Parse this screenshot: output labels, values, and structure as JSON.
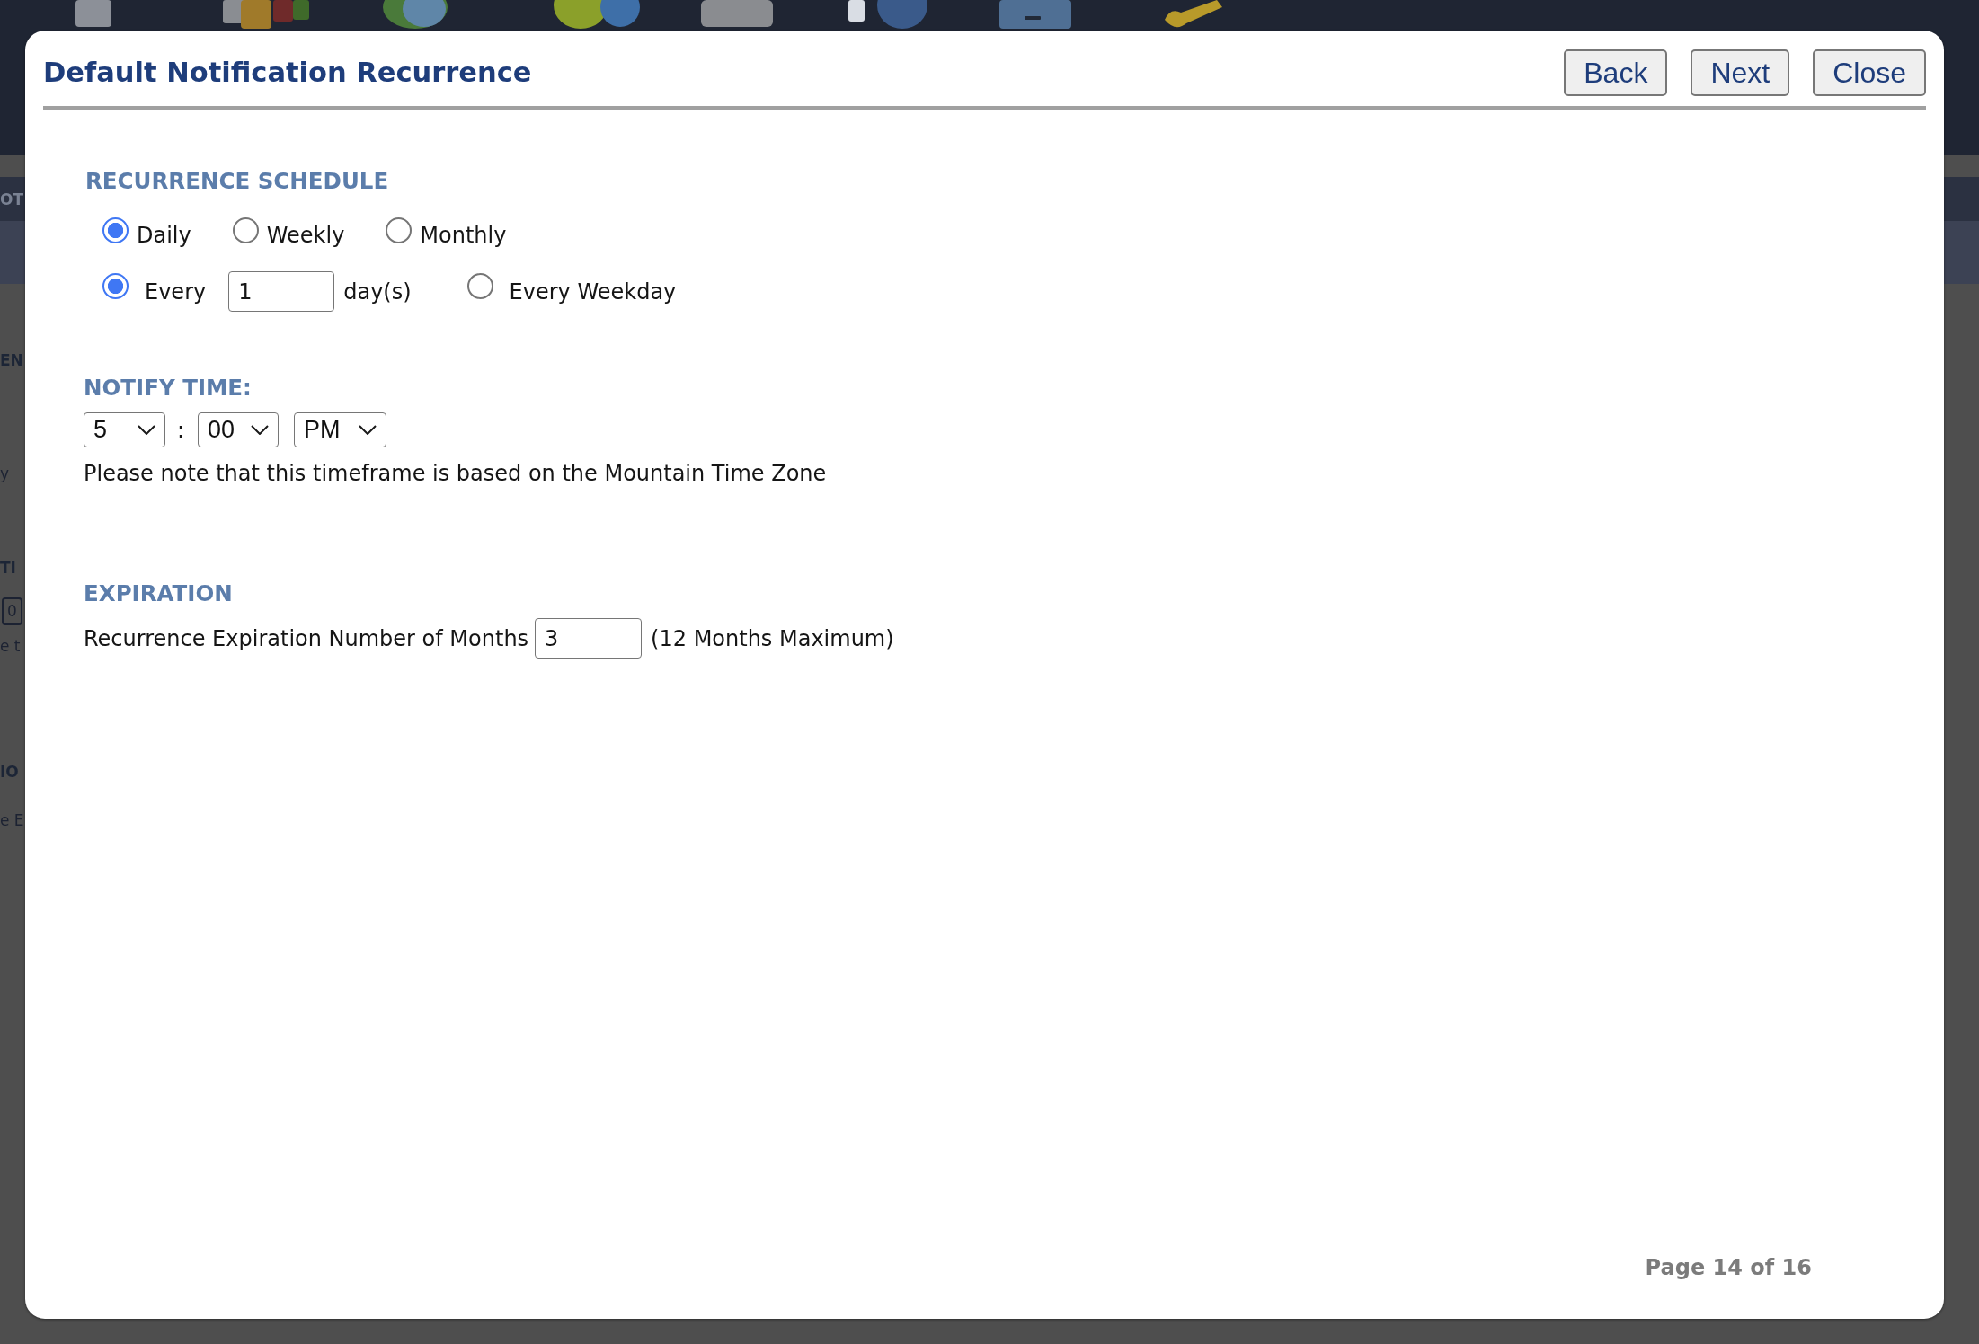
{
  "background_page": {
    "fragments": [
      {
        "kind": "tab",
        "text": "OT"
      },
      {
        "kind": "heading",
        "text": "EN"
      },
      {
        "kind": "text",
        "text": "y"
      },
      {
        "kind": "heading",
        "text": "TI"
      },
      {
        "kind": "field",
        "text": "0"
      },
      {
        "kind": "text",
        "text": "e t"
      },
      {
        "kind": "heading",
        "text": "IO"
      },
      {
        "kind": "text",
        "text": "e E"
      }
    ]
  },
  "dialog": {
    "title": "Default Notification Recurrence",
    "buttons": [
      "Back",
      "Next",
      "Close"
    ],
    "recurrence_schedule": {
      "heading": "RECURRENCE SCHEDULE",
      "frequency_options": [
        {
          "label": "Daily",
          "selected": true
        },
        {
          "label": "Weekly",
          "selected": false
        },
        {
          "label": "Monthly",
          "selected": false
        }
      ],
      "daily_options": [
        {
          "kind": "interval",
          "label": "Every",
          "value": "1",
          "unit": "day(s)",
          "selected": true
        },
        {
          "kind": "plain",
          "label": "Every Weekday",
          "selected": false
        }
      ]
    },
    "notify_time": {
      "heading": "NOTIFY TIME:",
      "hour": "5",
      "separator": ":",
      "minute": "00",
      "period": "PM",
      "note": "Please note that this timeframe is based on the Mountain Time Zone"
    },
    "expiration": {
      "heading": "EXPIRATION",
      "label": "Recurrence Expiration Number of Months",
      "value": "3",
      "hint": "(12 Months Maximum)"
    },
    "page_indicator": "Page 14 of 16"
  }
}
